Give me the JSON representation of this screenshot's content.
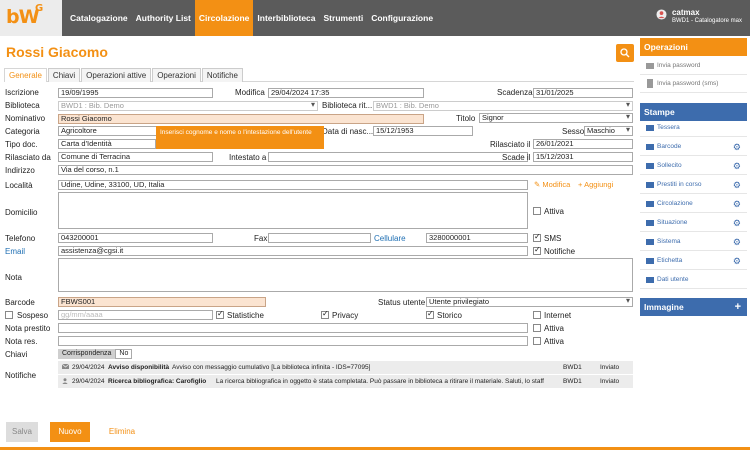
{
  "app": {
    "logo": "bW",
    "logo_sup": "G"
  },
  "nav": [
    "Catalogazione",
    "Authority List",
    "Circolazione",
    "Interbiblioteca",
    "Strumenti",
    "Configurazione"
  ],
  "nav_active": "Circolazione",
  "user": {
    "name": "catmax",
    "role": "BWD1 - Catalogatore max"
  },
  "page_title": "Rossi Giacomo",
  "tabs": [
    "Generale",
    "Chiavi",
    "Operazioni attive",
    "Operazioni",
    "Notifiche"
  ],
  "tab_active": "Generale",
  "form": {
    "iscrizione_label": "Iscrizione",
    "iscrizione": "19/09/1995",
    "modifica_label": "Modifica",
    "modifica": "29/04/2024 17:35",
    "scadenza_label": "Scadenza",
    "scadenza": "31/01/2025",
    "biblioteca_label": "Biblioteca",
    "biblioteca": "BWD1 : Bib. Demo",
    "biblioteca_rit_label": "Biblioteca rit...",
    "biblioteca_rit": "BWD1 : Bib. Demo",
    "nominativo_label": "Nominativo",
    "nominativo": "Rossi Giacomo",
    "titolo_label": "Titolo",
    "titolo": "Signor",
    "categoria_label": "Categoria",
    "categoria": "Agricoltore",
    "data_nascita_label": "Data di nasc...",
    "data_nascita": "15/12/1953",
    "sesso_label": "Sesso",
    "sesso": "Maschio",
    "tipo_doc_label": "Tipo doc.",
    "tipo_doc": "Carta d'Identità",
    "rilasciato_il_label": "Rilasciato il",
    "rilasciato_il": "26/01/2021",
    "rilasciato_da_label": "Rilasciato da",
    "rilasciato_da": "Comune di Terracina",
    "intestato_label": "Intestato a",
    "intestato": "",
    "scade_label": "Scade il",
    "scade": "15/12/2031",
    "indirizzo_label": "Indirizzo",
    "indirizzo": "Via del corso, n.1",
    "localita_label": "Località",
    "localita": "Udine, Udine, 33100, UD, Italia",
    "modifica_link": "Modifica",
    "aggiungi_link": "Aggiungi",
    "domicilio_label": "Domicilio",
    "attiva_label": "Attiva",
    "telefono_label": "Telefono",
    "telefono": "043200001",
    "fax_label": "Fax",
    "fax": "",
    "cellulare_label": "Cellulare",
    "cellulare": "3280000001",
    "sms_label": "SMS",
    "email_label": "Email",
    "email": "assistenza@cgsi.it",
    "notifiche_label": "Notifiche",
    "nota_label": "Nota",
    "barcode_label": "Barcode",
    "barcode": "FBWS001",
    "status_label": "Status utente",
    "status": "Utente privilegiato",
    "sospeso_label": "Sospeso",
    "sospeso_placeholder": "gg/mm/aaaa",
    "statistiche_label": "Statistiche",
    "privacy_label": "Privacy",
    "storico_label": "Storico",
    "internet_label": "Internet",
    "nota_prestito_label": "Nota prestito",
    "nota_res_label": "Nota res.",
    "chiavi_label": "Chiavi",
    "chiavi_key": "Corrispondenza",
    "chiavi_value": "No"
  },
  "tooltip": "Inserisci cognome e nome o l'intestazione dell'utente",
  "notifications": [
    {
      "date": "29/04/2024",
      "title": "Avviso disponibilità",
      "text": "Avviso con messaggio cumulativo [La biblioteca infinita - IDS=77095]",
      "lib": "BWD1",
      "state": "Inviato"
    },
    {
      "date": "29/04/2024",
      "title": "Ricerca bibliografica: Carofiglio",
      "text": "La ricerca bibliografica in oggetto è stata completata. Può passare in biblioteca a ritirare il materiale. Saluti, lo staff",
      "lib": "BWD1",
      "state": "Inviato"
    }
  ],
  "buttons": {
    "salva": "Salva",
    "nuovo": "Nuovo",
    "elimina": "Elimina"
  },
  "panel": {
    "operazioni": "Operazioni",
    "op_items": [
      "Invia password",
      "Invia password (sms)"
    ],
    "stampe": "Stampe",
    "stampe_items": [
      "Tessera",
      "Barcode",
      "Sollecito",
      "Prestiti in corso",
      "Circolazione",
      "Situazione",
      "Sistema",
      "Etichetta",
      "Dati utente"
    ],
    "immagine": "Immagine"
  },
  "colors": {
    "accent": "#f39014",
    "blue": "#3d6cad",
    "topbar": "#5b5b5b"
  }
}
